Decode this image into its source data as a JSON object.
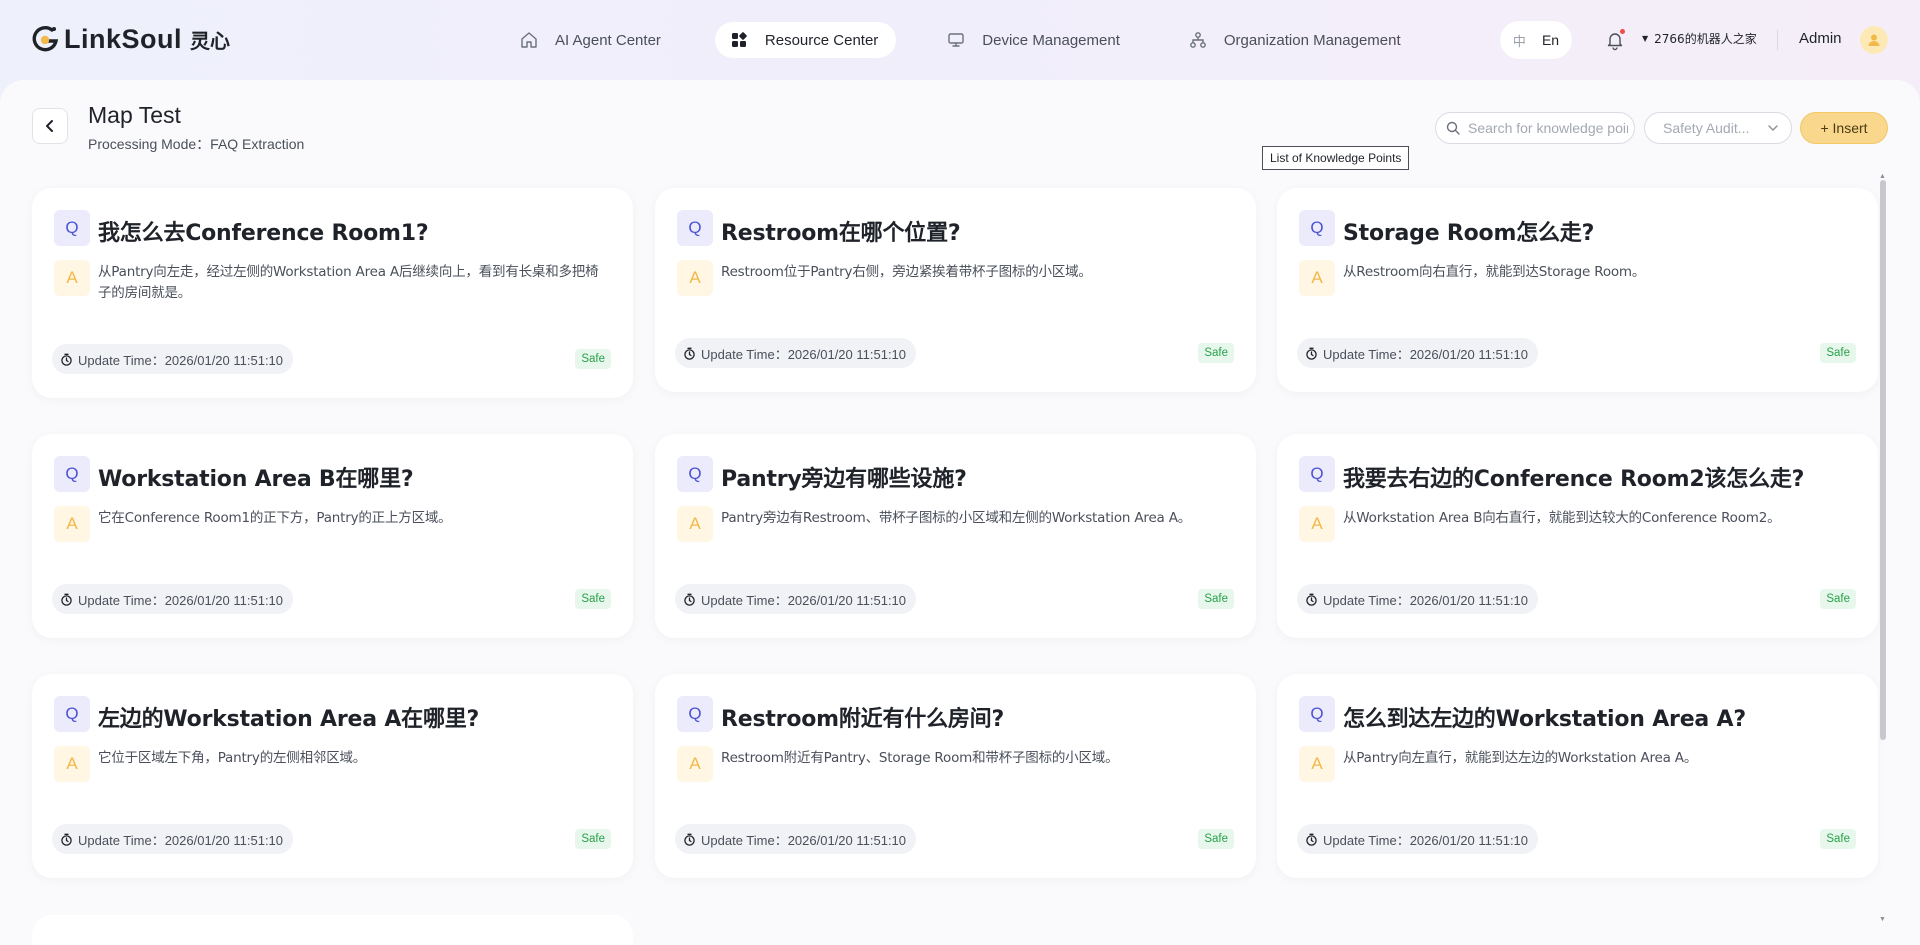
{
  "header": {
    "logo_text": "LinkSoul",
    "logo_cn": "灵心",
    "nav": [
      {
        "label": "AI Agent Center",
        "icon": "home-icon",
        "active": false
      },
      {
        "label": "Resource Center",
        "icon": "grid-icon",
        "active": true
      },
      {
        "label": "Device Management",
        "icon": "monitor-icon",
        "active": false
      },
      {
        "label": "Organization Management",
        "icon": "org-chart-icon",
        "active": false
      }
    ],
    "lang": {
      "zh": "中",
      "en": "En",
      "selected": "En"
    },
    "workspace": "2766的机器人之家",
    "user": "Admin"
  },
  "page": {
    "title": "Map Test",
    "subtitle": "Processing Mode：FAQ Extraction",
    "search_placeholder": "Search for knowledge points",
    "filter_placeholder": "Safety Audit...",
    "insert_label": "+ Insert",
    "tooltip": "List of Knowledge Points"
  },
  "cards": [
    {
      "q": "我怎么去Conference Room1?",
      "a": "从Pantry向左走，经过左侧的Workstation Area A后继续向上，看到有长桌和多把椅子的房间就是。",
      "time": "Update Time：2026/01/20 11:51:10",
      "status": "Safe"
    },
    {
      "q": "Restroom在哪个位置?",
      "a": "Restroom位于Pantry右侧，旁边紧挨着带杯子图标的小区域。",
      "time": "Update Time：2026/01/20 11:51:10",
      "status": "Safe"
    },
    {
      "q": "Storage Room怎么走?",
      "a": "从Restroom向右直行，就能到达Storage Room。",
      "time": "Update Time：2026/01/20 11:51:10",
      "status": "Safe"
    },
    {
      "q": "Workstation Area B在哪里?",
      "a": "它在Conference Room1的正下方，Pantry的正上方区域。",
      "time": "Update Time：2026/01/20 11:51:10",
      "status": "Safe"
    },
    {
      "q": "Pantry旁边有哪些设施?",
      "a": "Pantry旁边有Restroom、带杯子图标的小区域和左侧的Workstation Area A。",
      "time": "Update Time：2026/01/20 11:51:10",
      "status": "Safe"
    },
    {
      "q": "我要去右边的Conference Room2该怎么走?",
      "a": "从Workstation Area B向右直行，就能到达较大的Conference Room2。",
      "time": "Update Time：2026/01/20 11:51:10",
      "status": "Safe"
    },
    {
      "q": "左边的Workstation Area A在哪里?",
      "a": "它位于区域左下角，Pantry的左侧相邻区域。",
      "time": "Update Time：2026/01/20 11:51:10",
      "status": "Safe"
    },
    {
      "q": "Restroom附近有什么房间?",
      "a": "Restroom附近有Pantry、Storage Room和带杯子图标的小区域。",
      "time": "Update Time：2026/01/20 11:51:10",
      "status": "Safe"
    },
    {
      "q": "怎么到达左边的Workstation Area A?",
      "a": "从Pantry向左直行，就能到达左边的Workstation Area A。",
      "time": "Update Time：2026/01/20 11:51:10",
      "status": "Safe"
    }
  ],
  "badges": {
    "q": "Q",
    "a": "A"
  }
}
